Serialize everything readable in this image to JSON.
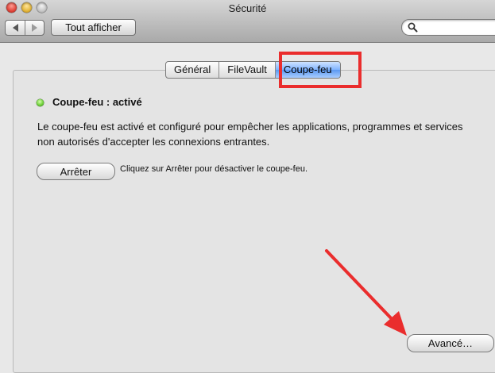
{
  "window": {
    "title": "Sécurité"
  },
  "toolbar": {
    "back_icon": "chevron-left-icon",
    "forward_icon": "chevron-right-icon",
    "show_all_label": "Tout afficher",
    "search_placeholder": "",
    "search_value": ""
  },
  "tabs": [
    {
      "label": "Général",
      "active": false
    },
    {
      "label": "FileVault",
      "active": false
    },
    {
      "label": "Coupe-feu",
      "active": true
    }
  ],
  "firewall": {
    "status_label": "Coupe-feu : activé",
    "status_color": "#5fc432",
    "description": "Le coupe-feu est activé et configuré pour empêcher les applications, programmes et services non autorisés d'accepter les connexions entrantes.",
    "stop_button_label": "Arrêter",
    "stop_hint": "Cliquez sur Arrêter pour désactiver le coupe-feu.",
    "advanced_button_label": "Avancé…"
  },
  "annotations": {
    "highlight_color": "#ea2d2d"
  }
}
